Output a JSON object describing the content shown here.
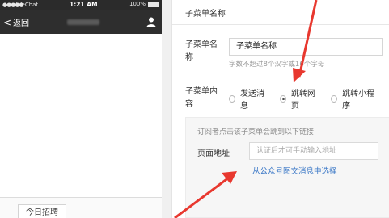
{
  "phone": {
    "status_bar": {
      "carrier": "WeChat",
      "time": "1:21 AM",
      "battery": "100%"
    },
    "nav": {
      "back_label": "返回"
    },
    "menu_button_label": "今日招聘"
  },
  "panel": {
    "title": "子菜单名称",
    "name_label": "子菜单名称",
    "name_value": "子菜单名称",
    "name_hint": "字数不超过8个汉字或16个字母",
    "content_label": "子菜单内容",
    "content_options": [
      {
        "label": "发送消息",
        "selected": false
      },
      {
        "label": "跳转网页",
        "selected": true
      },
      {
        "label": "跳转小程序",
        "selected": false
      }
    ],
    "subscriber_hint": "订阅者点击该子菜单会跳到以下链接",
    "page_address_label": "页面地址",
    "page_address_placeholder": "认证后才可手动输入地址",
    "choose_link": "从公众号图文消息中选择"
  },
  "colors": {
    "annotation_red": "#e8382f",
    "link_blue": "#3b78c7",
    "nav_dark": "#2e2e2e"
  },
  "icons": [
    "back-chevron-icon",
    "user-icon",
    "signal-icon",
    "battery-icon",
    "annotation-arrow"
  ]
}
